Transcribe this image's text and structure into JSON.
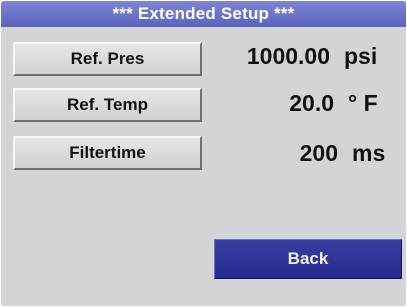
{
  "title": "***   Extended Setup ***",
  "settings": [
    {
      "label": "Ref. Pres",
      "value": "1000.00",
      "unit": "psi"
    },
    {
      "label": "Ref. Temp",
      "value": "20.0",
      "unit": "° F"
    },
    {
      "label": "Filtertime",
      "value": "200",
      "unit": "ms"
    }
  ],
  "back_label": "Back",
  "colors": {
    "background": "#d3d4d6",
    "title_bar": "#6a72c8",
    "back_button": "#2f3397",
    "text": "#111111"
  }
}
